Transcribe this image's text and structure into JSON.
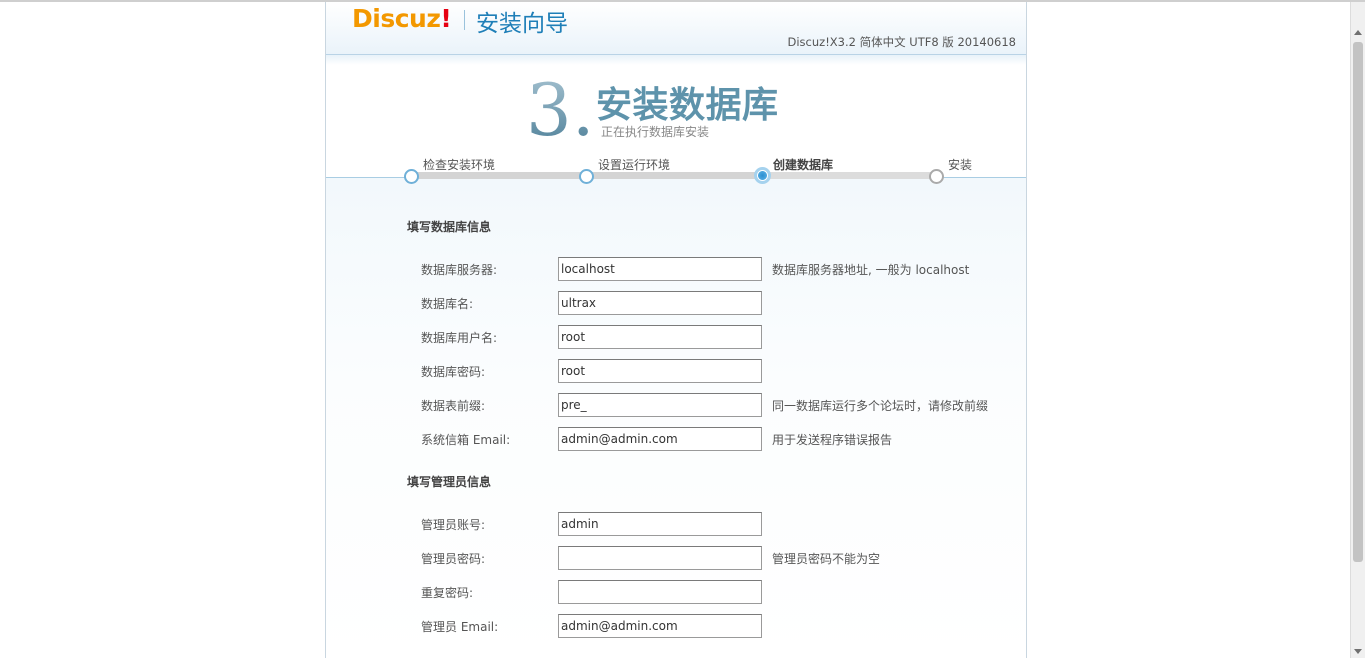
{
  "header": {
    "logo_text": "Discuz",
    "logo_bang": "!",
    "wizard_title": "安装向导",
    "version": "Discuz!X3.2 简体中文 UTF8 版 20140618"
  },
  "step": {
    "number": "3.",
    "title": "安装数据库",
    "subtitle": "正在执行数据库安装"
  },
  "progress": {
    "steps": [
      {
        "label": "检查安装环境",
        "state": "done"
      },
      {
        "label": "设置运行环境",
        "state": "done"
      },
      {
        "label": "创建数据库",
        "state": "current"
      },
      {
        "label": "安装",
        "state": "pending"
      }
    ],
    "accent_color": "#2b8fd1"
  },
  "db_section": {
    "title": "填写数据库信息",
    "fields": [
      {
        "label": "数据库服务器:",
        "value": "localhost",
        "hint": "数据库服务器地址, 一般为 localhost"
      },
      {
        "label": "数据库名:",
        "value": "ultrax",
        "hint": ""
      },
      {
        "label": "数据库用户名:",
        "value": "root",
        "hint": ""
      },
      {
        "label": "数据库密码:",
        "value": "root",
        "hint": ""
      },
      {
        "label": "数据表前缀:",
        "value": "pre_",
        "hint": "同一数据库运行多个论坛时，请修改前缀"
      },
      {
        "label": "系统信箱 Email:",
        "value": "admin@admin.com",
        "hint": "用于发送程序错误报告"
      }
    ]
  },
  "admin_section": {
    "title": "填写管理员信息",
    "fields": [
      {
        "label": "管理员账号:",
        "value": "admin",
        "hint": ""
      },
      {
        "label": "管理员密码:",
        "value": "",
        "hint": "管理员密码不能为空"
      },
      {
        "label": "重复密码:",
        "value": "",
        "hint": ""
      },
      {
        "label": "管理员 Email:",
        "value": "admin@admin.com",
        "hint": ""
      }
    ]
  }
}
